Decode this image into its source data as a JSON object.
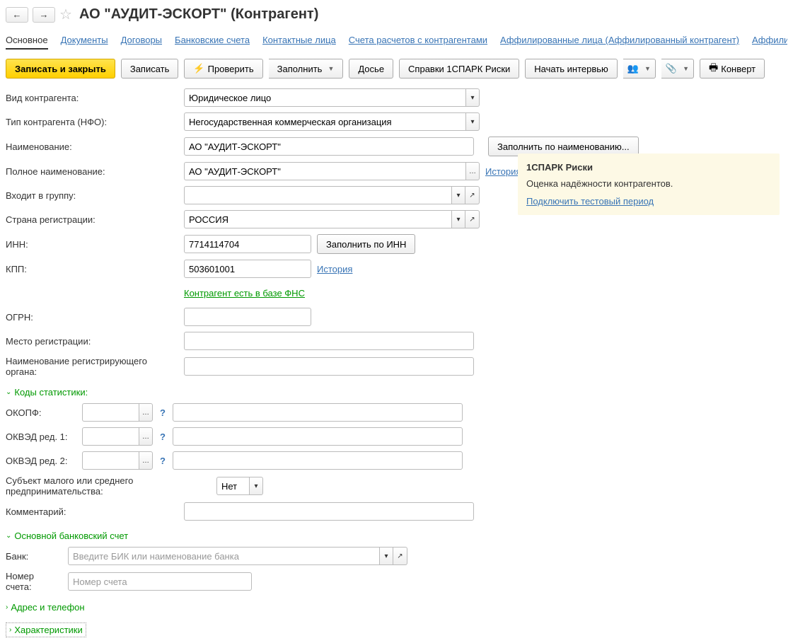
{
  "header": {
    "title": "АО \"АУДИТ-ЭСКОРТ\" (Контрагент)"
  },
  "tabs": [
    "Основное",
    "Документы",
    "Договоры",
    "Банковские счета",
    "Контактные лица",
    "Счета расчетов с контрагентами",
    "Аффилированные лица (Аффилированный контрагент)",
    "Аффилирс"
  ],
  "toolbar": {
    "write_close": "Записать и закрыть",
    "write": "Записать",
    "check": "Проверить",
    "fill": "Заполнить",
    "dossier": "Досье",
    "spark": "Справки 1СПАРК Риски",
    "interview": "Начать интервью",
    "convert": "Конверт"
  },
  "form": {
    "kind_label": "Вид контрагента:",
    "kind_value": "Юридическое лицо",
    "nfo_label": "Тип контрагента (НФО):",
    "nfo_value": "Негосударственная коммерческая организация",
    "name_label": "Наименование:",
    "name_value": "АО \"АУДИТ-ЭСКОРТ\"",
    "fill_by_name": "Заполнить по наименованию...",
    "fullname_label": "Полное наименование:",
    "fullname_value": "АО \"АУДИТ-ЭСКОРТ\"",
    "history_link": "История",
    "group_label": "Входит в группу:",
    "group_value": "",
    "country_label": "Страна регистрации:",
    "country_value": "РОССИЯ",
    "inn_label": "ИНН:",
    "inn_value": "7714114704",
    "fill_by_inn": "Заполнить по ИНН",
    "kpp_label": "КПП:",
    "kpp_value": "503601001",
    "fns_link": "Контрагент есть в базе ФНС",
    "ogrn_label": "ОГРН:",
    "ogrn_value": "",
    "regplace_label": "Место регистрации:",
    "regplace_value": "",
    "regorg_label": "Наименование регистрирующего органа:",
    "regorg_value": ""
  },
  "stats": {
    "header": "Коды статистики:",
    "okopf_label": "ОКОПФ:",
    "okved1_label": "ОКВЭД ред. 1:",
    "okved2_label": "ОКВЭД ред. 2:",
    "sme_label": "Субъект малого или среднего предпринимательства:",
    "sme_value": "Нет",
    "comment_label": "Комментарий:"
  },
  "bank": {
    "header": "Основной банковский счет",
    "bank_label": "Банк:",
    "bank_placeholder": "Введите БИК или наименование банка",
    "acct_label": "Номер счета:",
    "acct_placeholder": "Номер счета"
  },
  "sections": {
    "address": "Адрес и телефон",
    "chars": "Характеристики"
  },
  "spark": {
    "title": "1СПАРК Риски",
    "desc": "Оценка надёжности контрагентов.",
    "link": "Подключить тестовый период"
  }
}
